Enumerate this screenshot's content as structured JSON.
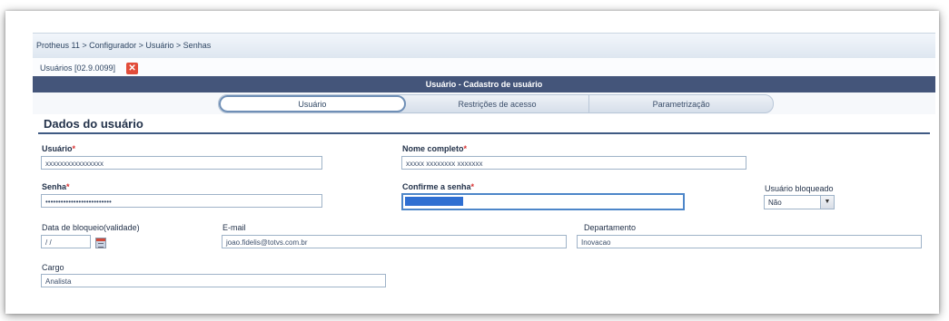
{
  "breadcrumb": "Protheus 11 > Configurador > Usuário > Senhas",
  "doc_tab": {
    "label": "Usuários [02.9.0099]",
    "close": "✕"
  },
  "window_title": "Usuário - Cadastro de usuário",
  "tabs": [
    {
      "label": "Usuário",
      "active": true
    },
    {
      "label": "Restrições de acesso",
      "active": false
    },
    {
      "label": "Parametrização",
      "active": false
    }
  ],
  "section_title": "Dados do usuário",
  "required_mark": "*",
  "fields": {
    "usuario": {
      "label": "Usuário",
      "value": "xxxxxxxxxxxxxxxx"
    },
    "nome_completo": {
      "label": "Nome completo",
      "value": "xxxxx xxxxxxxx xxxxxxx"
    },
    "senha": {
      "label": "Senha",
      "value": "••••••••••••••••••••••••••"
    },
    "confirme_senha": {
      "label": "Confirme a senha",
      "value": ""
    },
    "usuario_bloqueado": {
      "label": "Usuário bloqueado",
      "value": "Não"
    },
    "data_bloqueio": {
      "label": "Data de bloqueio(validade)",
      "value": "/ /"
    },
    "email": {
      "label": "E-mail",
      "value": "joao.fidelis@totvs.com.br"
    },
    "departamento": {
      "label": "Departamento",
      "value": "Inovacao"
    },
    "cargo": {
      "label": "Cargo",
      "value": "Analista"
    }
  },
  "colors": {
    "title_bar": "#44557a",
    "section_line": "#3f5a83",
    "required": "#d83030",
    "close_button": "#e24d3a",
    "focus_border": "#4d86c9",
    "selection": "#2f6fd2"
  },
  "icons": {
    "calendar": "calendar-icon",
    "dropdown": "chevron-down-icon",
    "close": "close-icon"
  }
}
